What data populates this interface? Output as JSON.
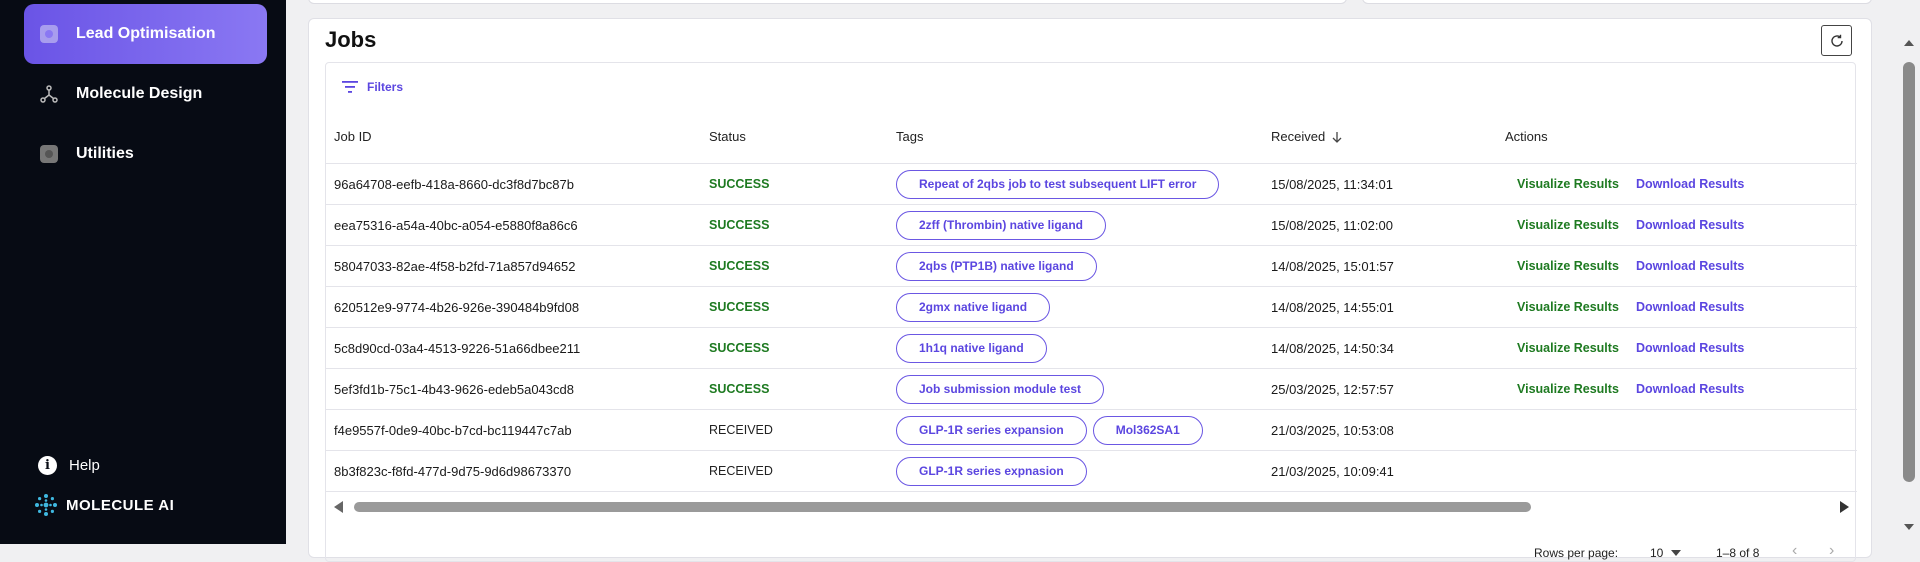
{
  "sidebar": {
    "items": [
      {
        "label": "Lead Optimisation",
        "icon": "lead-optimisation-icon",
        "active": true
      },
      {
        "label": "Molecule Design",
        "icon": "molecule-icon",
        "active": false
      },
      {
        "label": "Utilities",
        "icon": "utilities-icon",
        "active": false
      }
    ],
    "help_label": "Help",
    "brand": "MOLECULE AI"
  },
  "panel": {
    "title": "Jobs",
    "filters_label": "Filters",
    "columns": [
      "Job ID",
      "Status",
      "Tags",
      "Received",
      "Actions"
    ],
    "rows": [
      {
        "id": "96a64708-eefb-418a-8660-dc3f8d7bc87b",
        "status": "SUCCESS",
        "tags": [
          "Repeat of 2qbs job to test subsequent LIFT error"
        ],
        "received": "15/08/2025, 11:34:01",
        "actions": [
          "Visualize Results",
          "Download Results"
        ]
      },
      {
        "id": "eea75316-a54a-40bc-a054-e5880f8a86c6",
        "status": "SUCCESS",
        "tags": [
          "2zff (Thrombin) native ligand"
        ],
        "received": "15/08/2025, 11:02:00",
        "actions": [
          "Visualize Results",
          "Download Results"
        ]
      },
      {
        "id": "58047033-82ae-4f58-b2fd-71a857d94652",
        "status": "SUCCESS",
        "tags": [
          "2qbs (PTP1B) native ligand"
        ],
        "received": "14/08/2025, 15:01:57",
        "actions": [
          "Visualize Results",
          "Download Results"
        ]
      },
      {
        "id": "620512e9-9774-4b26-926e-390484b9fd08",
        "status": "SUCCESS",
        "tags": [
          "2gmx native ligand"
        ],
        "received": "14/08/2025, 14:55:01",
        "actions": [
          "Visualize Results",
          "Download Results"
        ]
      },
      {
        "id": "5c8d90cd-03a4-4513-9226-51a66dbee211",
        "status": "SUCCESS",
        "tags": [
          "1h1q native ligand"
        ],
        "received": "14/08/2025, 14:50:34",
        "actions": [
          "Visualize Results",
          "Download Results"
        ]
      },
      {
        "id": "5ef3fd1b-75c1-4b43-9626-edeb5a043cd8",
        "status": "SUCCESS",
        "tags": [
          "Job submission module test"
        ],
        "received": "25/03/2025, 12:57:57",
        "actions": [
          "Visualize Results",
          "Download Results"
        ]
      },
      {
        "id": "f4e9557f-0de9-40bc-b7cd-bc119447c7ab",
        "status": "RECEIVED",
        "tags": [
          "GLP-1R series expansion",
          "Mol362SA1"
        ],
        "received": "21/03/2025, 10:53:08",
        "actions": []
      },
      {
        "id": "8b3f823c-f8fd-477d-9d75-9d6d98673370",
        "status": "RECEIVED",
        "tags": [
          "GLP-1R series expnasion"
        ],
        "received": "21/03/2025, 10:09:41",
        "actions": []
      }
    ],
    "pagination": {
      "rows_per_page_label": "Rows per page:",
      "rows_per_page": "10",
      "range": "1–8 of 8"
    }
  },
  "colors": {
    "sidebar_bg": "#070b14",
    "accent": "#5b46e0",
    "success": "#1e7a21"
  }
}
